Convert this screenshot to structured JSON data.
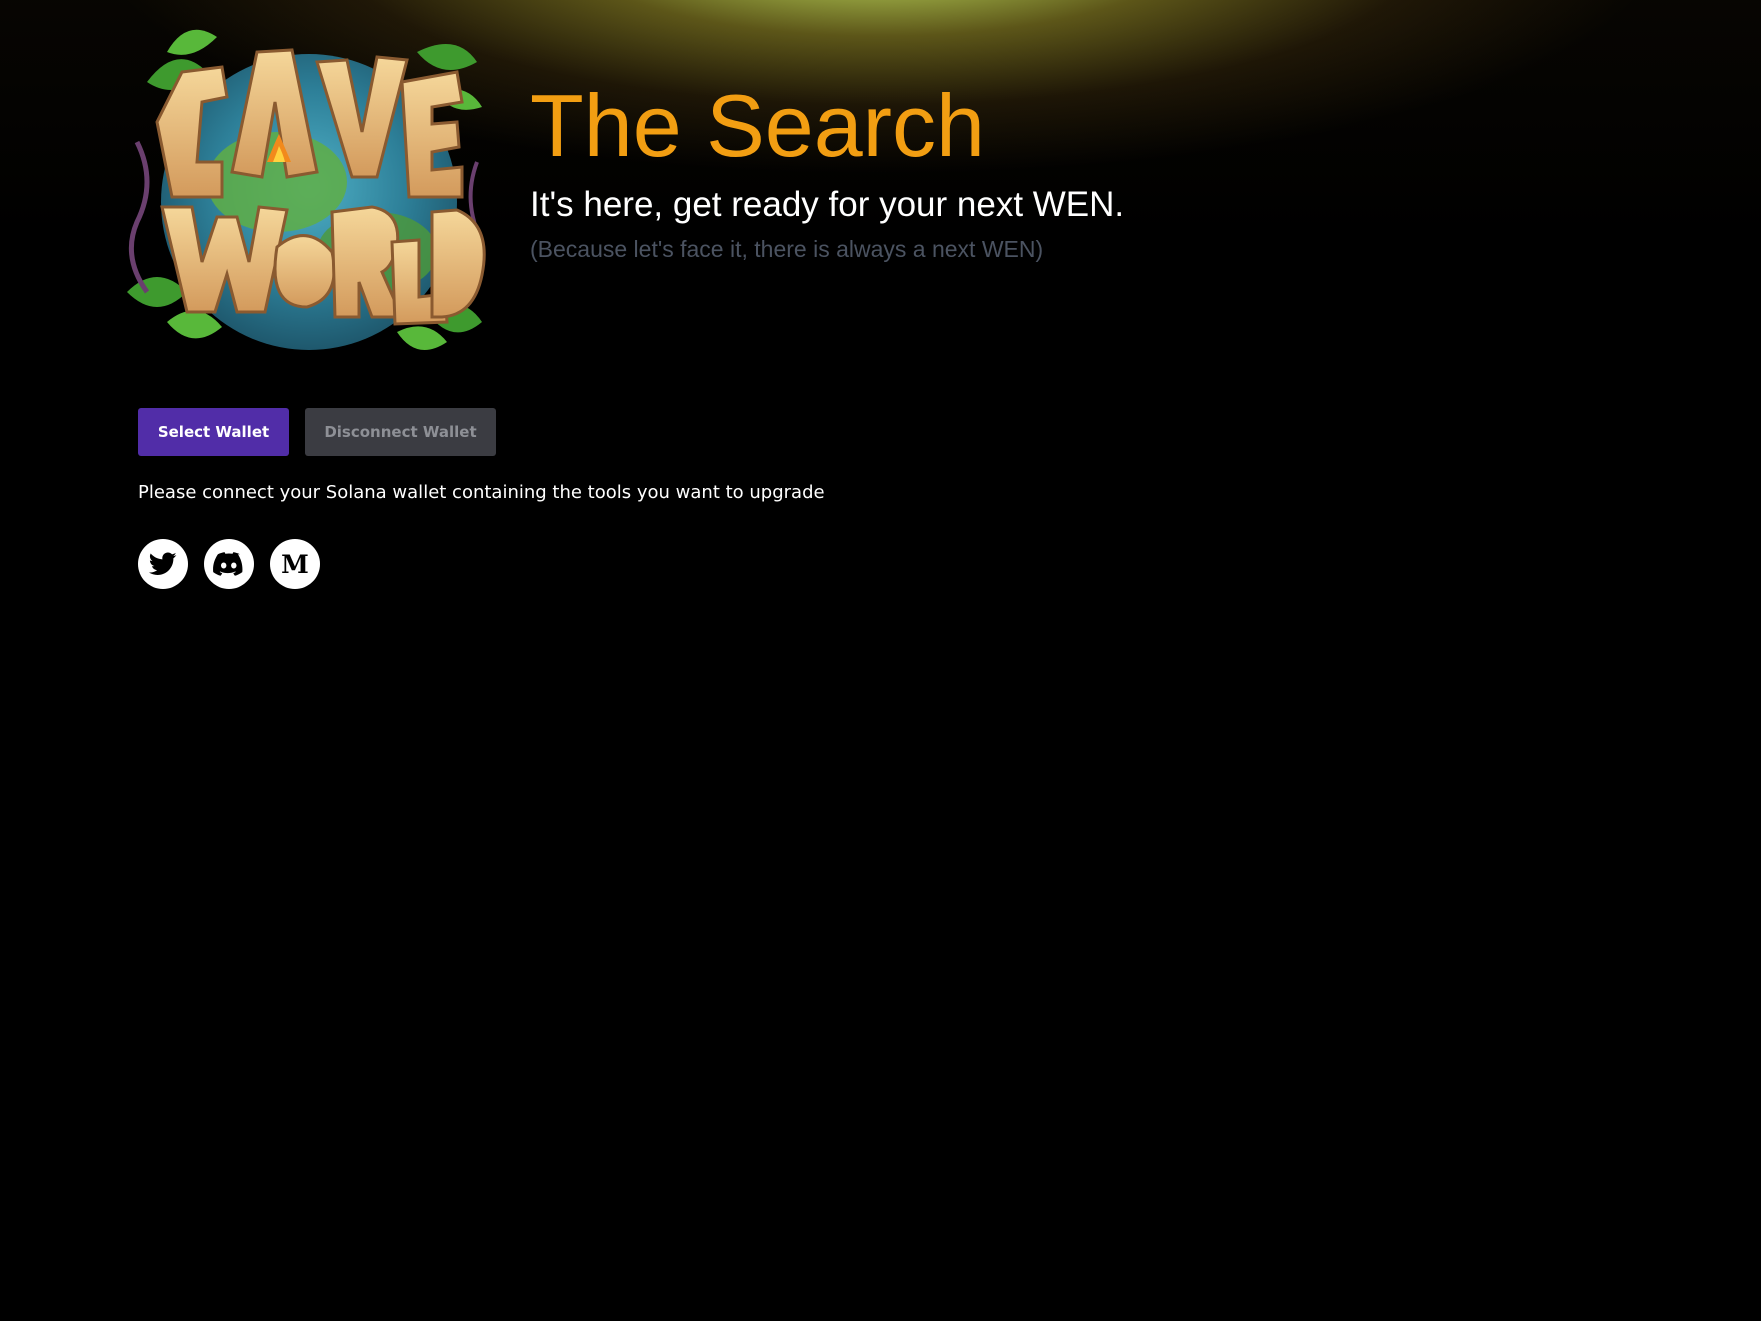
{
  "header": {
    "logo": {
      "text_line1": "CAVE",
      "text_line2": "WORLD",
      "icon": "cave-world-logo-icon"
    },
    "title": "The Search",
    "subtitle": "It's here, get ready for your next WEN.",
    "tagline": "(Because let's face it, there is always a next WEN)"
  },
  "wallet": {
    "select_label": "Select Wallet",
    "disconnect_label": "Disconnect Wallet",
    "hint": "Please connect your Solana wallet containing the tools you want to upgrade"
  },
  "social": [
    {
      "icon": "twitter-icon"
    },
    {
      "icon": "discord-icon"
    },
    {
      "icon": "medium-icon",
      "glyph": "M"
    }
  ],
  "colors": {
    "background": "#000000",
    "title": "#f29e12",
    "subtitle": "#ffffff",
    "tagline": "#4b5361",
    "primary_button": "#512da8",
    "secondary_button": "#3b3c42",
    "glow": "#bee470"
  }
}
